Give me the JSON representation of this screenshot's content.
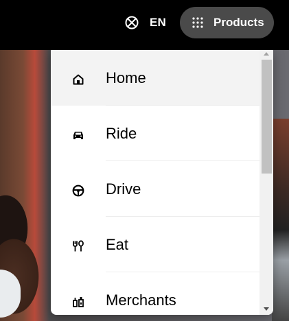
{
  "header": {
    "language_label": "EN",
    "products_label": "Products",
    "colors": {
      "bar": "#000000",
      "products_button": "#4a4a4a"
    }
  },
  "menu": {
    "items": [
      {
        "label": "Home",
        "icon": "home-icon",
        "active": true
      },
      {
        "label": "Ride",
        "icon": "car-icon",
        "active": false
      },
      {
        "label": "Drive",
        "icon": "steering-wheel-icon",
        "active": false
      },
      {
        "label": "Eat",
        "icon": "fork-spoon-icon",
        "active": false
      },
      {
        "label": "Merchants",
        "icon": "store-icon",
        "active": false
      }
    ]
  }
}
